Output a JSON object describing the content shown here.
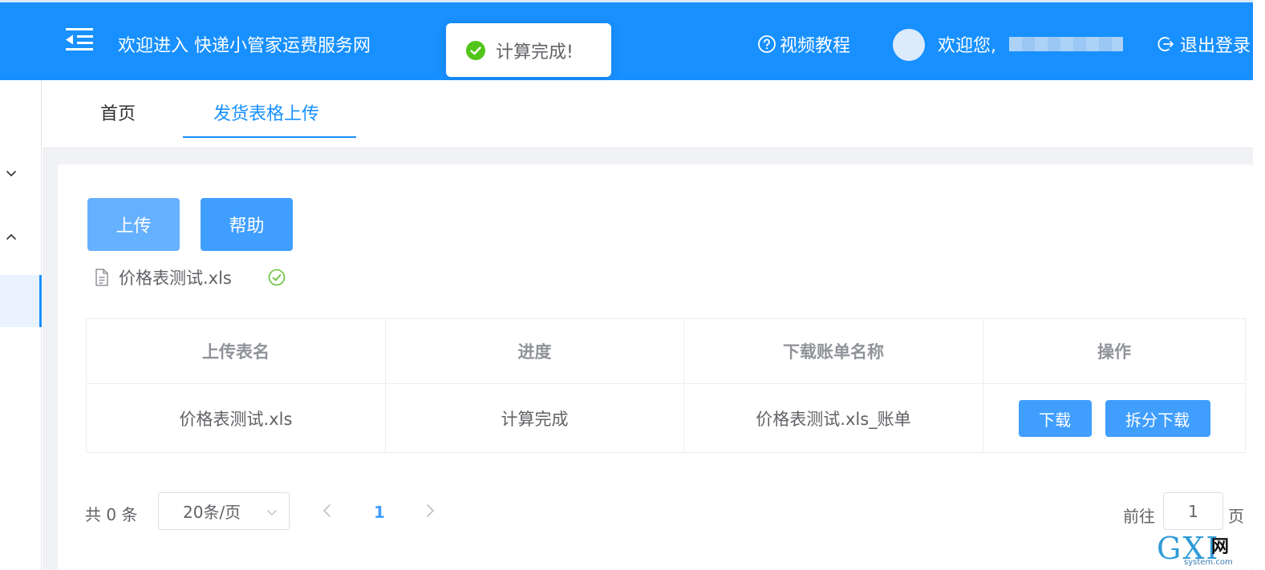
{
  "header": {
    "title": "欢迎进入 快递小管家运费服务网",
    "video_tutorial": "视频教程",
    "welcome": "欢迎您,",
    "logout": "退出登录"
  },
  "toast": {
    "message": "计算完成!"
  },
  "tabs": [
    {
      "label": "首页"
    },
    {
      "label": "发货表格上传"
    }
  ],
  "actions": {
    "upload": "上传",
    "help": "帮助"
  },
  "uploaded_file": {
    "name": "价格表测试.xls"
  },
  "table": {
    "headers": [
      "上传表名",
      "进度",
      "下载账单名称",
      "操作"
    ],
    "rows": [
      {
        "file": "价格表测试.xls",
        "progress": "计算完成",
        "bill": "价格表测试.xls_账单",
        "download": "下载",
        "split_download": "拆分下载"
      }
    ]
  },
  "pagination": {
    "total": "共 0 条",
    "page_size": "20条/页",
    "current_page": "1",
    "goto_label": "前往",
    "goto_value": "1",
    "goto_suffix": "页"
  },
  "watermark": {
    "brand": "GXI",
    "net": "网",
    "url": "system.com"
  },
  "colors": {
    "primary": "#1890ff",
    "button": "#409eff",
    "button_light": "#66b1ff",
    "success": "#52c41a"
  }
}
